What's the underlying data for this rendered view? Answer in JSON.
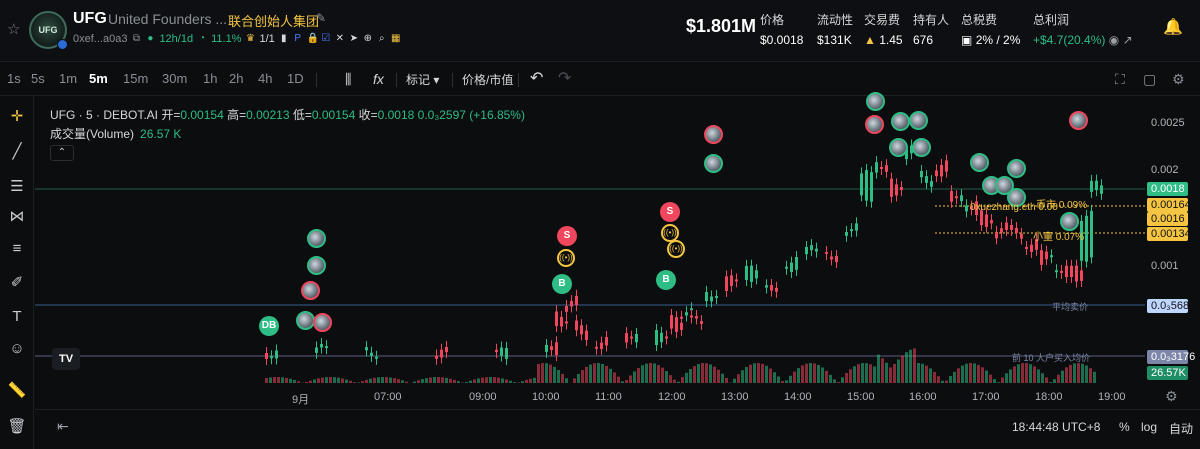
{
  "header": {
    "token_symbol": "UFG",
    "token_name": "United Founders ...",
    "token_cn_name": "联合创始人集团",
    "logo_text": "UFG",
    "address": "0xef...a0a3",
    "age": "12h/1d",
    "holder_pct": "11.1%",
    "crown_ratio": "1/1",
    "market_cap": "$1.801M",
    "stats": [
      {
        "label": "价格",
        "value": "$0.0018"
      },
      {
        "label": "流动性",
        "value": "$131K"
      },
      {
        "label": "交易费",
        "value": "1.45"
      },
      {
        "label": "持有人",
        "value": "676"
      },
      {
        "label": "总税费",
        "value": "2% / 2%"
      },
      {
        "label": "总利润",
        "value": "+$4.7(20.4%)"
      }
    ]
  },
  "toolbar": {
    "timeframes": [
      "1s",
      "5s",
      "1m",
      "5m",
      "15m",
      "30m",
      "1h",
      "2h",
      "4h",
      "1D"
    ],
    "active_timeframe": "5m",
    "indicators_label": "fx",
    "marks_label": "标记",
    "price_mode_label": "价格/市值"
  },
  "legend": {
    "title": "UFG · 5 · DEBOT.AI",
    "open_label": "开=",
    "open": "0.00154",
    "high_label": "高=",
    "high": "0.00213",
    "low_label": "低=",
    "low": "0.00154",
    "close_label": "收=",
    "close": "0.0018",
    "change": "0.0₃2597 (+16.85%)",
    "volume_label": "成交量(Volume)",
    "volume_value": "26.57 K"
  },
  "price_axis": {
    "ticks": [
      "0.0025",
      "0.002",
      "0.001"
    ],
    "labels": [
      {
        "value": "0.0018",
        "kind": "last"
      },
      {
        "value": "0.00164",
        "kind": "order"
      },
      {
        "value": "0.0016",
        "kind": "order"
      },
      {
        "value": "0.00134",
        "kind": "order"
      },
      {
        "value": "0.0₃5685",
        "kind": "avg-sell"
      },
      {
        "value": "0.0₃3176",
        "kind": "avg-buy"
      },
      {
        "value": "26.57K",
        "kind": "volume"
      }
    ],
    "avg_sell_text": "平均卖价",
    "avg_buy_text": "前 10 大户买入均价"
  },
  "chart_notes": [
    {
      "text": "0xuezhang.eth 0.00"
    },
    {
      "text": "小童 0.07%"
    },
    {
      "text": "币市 0.09%"
    }
  ],
  "time_axis": [
    "9月",
    "07:00",
    "09:00",
    "10:00",
    "11:00",
    "12:00",
    "13:00",
    "14:00",
    "15:00",
    "16:00",
    "17:00",
    "18:00",
    "19:00"
  ],
  "bottom": {
    "clock": "18:44:48 UTC+8",
    "pct": "%",
    "log": "log",
    "auto": "自动"
  },
  "colors": {
    "up": "#2ebd85",
    "down": "#f0475e",
    "accent_yellow": "#f5c542",
    "bg": "#0b0d0f"
  }
}
